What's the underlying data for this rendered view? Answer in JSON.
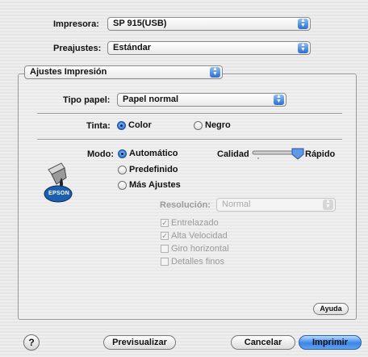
{
  "printer": {
    "label": "Impresora:",
    "value": "SP 915(USB)"
  },
  "presets": {
    "label": "Preajustes:",
    "value": "Estándar"
  },
  "section": {
    "value": "Ajustes Impresión"
  },
  "paper_type": {
    "label": "Tipo papel:",
    "value": "Papel normal"
  },
  "ink": {
    "label": "Tinta:",
    "options": [
      "Color",
      "Negro"
    ],
    "selected": "Color"
  },
  "mode": {
    "label": "Modo:",
    "options": [
      "Automático",
      "Predefinido",
      "Más Ajustes"
    ],
    "selected": "Automático"
  },
  "quality": {
    "label": "Calidad",
    "fast_label": "Rápido",
    "level": 1.0
  },
  "resolution": {
    "label": "Resolución:",
    "value": "Normal"
  },
  "checkboxes": [
    {
      "label": "Entrelazado",
      "checked": true
    },
    {
      "label": "Alta Velocidad",
      "checked": true
    },
    {
      "label": "Giro horizontal",
      "checked": false
    },
    {
      "label": "Detalles finos",
      "checked": false
    }
  ],
  "brand_logo": "EPSON",
  "buttons": {
    "help": "Ayuda",
    "help_icon": "?",
    "preview": "Previsualizar",
    "cancel": "Cancelar",
    "print": "Imprimir"
  },
  "colors": {
    "accent": "#3a86e8",
    "disabled_text": "#9a9a9a"
  }
}
